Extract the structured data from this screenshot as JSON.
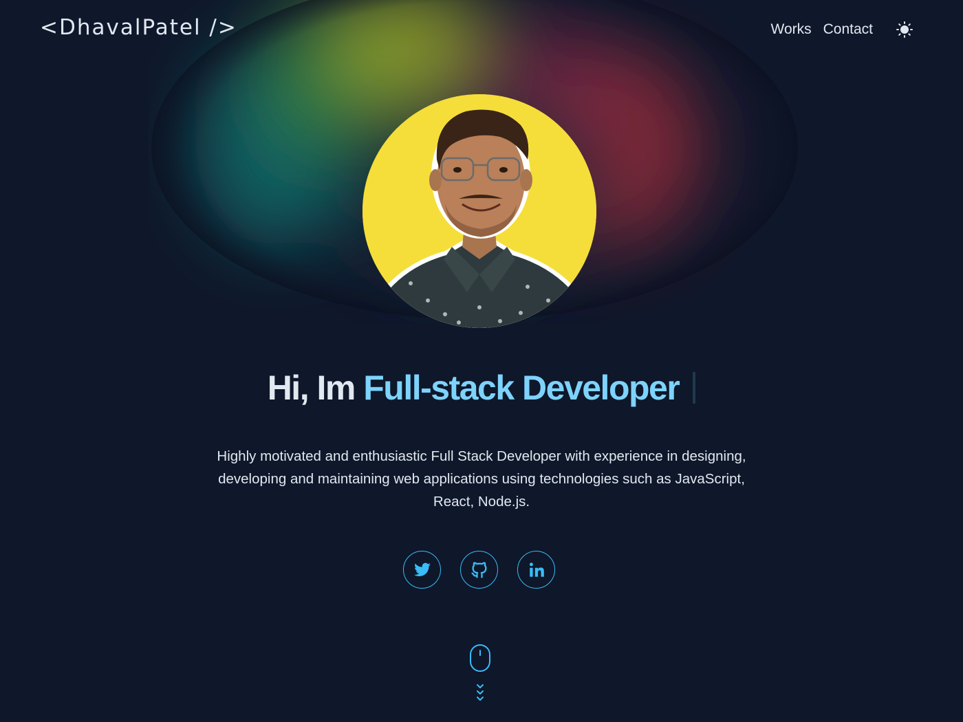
{
  "header": {
    "logo": "<DhavalPatel />",
    "nav": [
      {
        "label": "Works"
      },
      {
        "label": "Contact"
      }
    ],
    "theme_toggle_icon": "sun-icon"
  },
  "hero": {
    "avatar_icon": "profile-photo",
    "greeting": "Hi, Im ",
    "role": "Full-stack Developer",
    "bio": "Highly motivated and enthusiastic Full Stack Developer with experience in designing, developing and maintaining web applications using technologies such as JavaScript, React, Node.js.",
    "socials": [
      {
        "icon": "twitter-icon"
      },
      {
        "icon": "github-icon"
      },
      {
        "icon": "linkedin-icon"
      }
    ],
    "scroll_icon": "mouse-scroll-icon"
  },
  "colors": {
    "background": "#0f172a",
    "text": "#e2e8f0",
    "accent": "#7dd3fc",
    "icon_accent": "#38bdf8",
    "avatar_bg": "#f5de3a"
  }
}
